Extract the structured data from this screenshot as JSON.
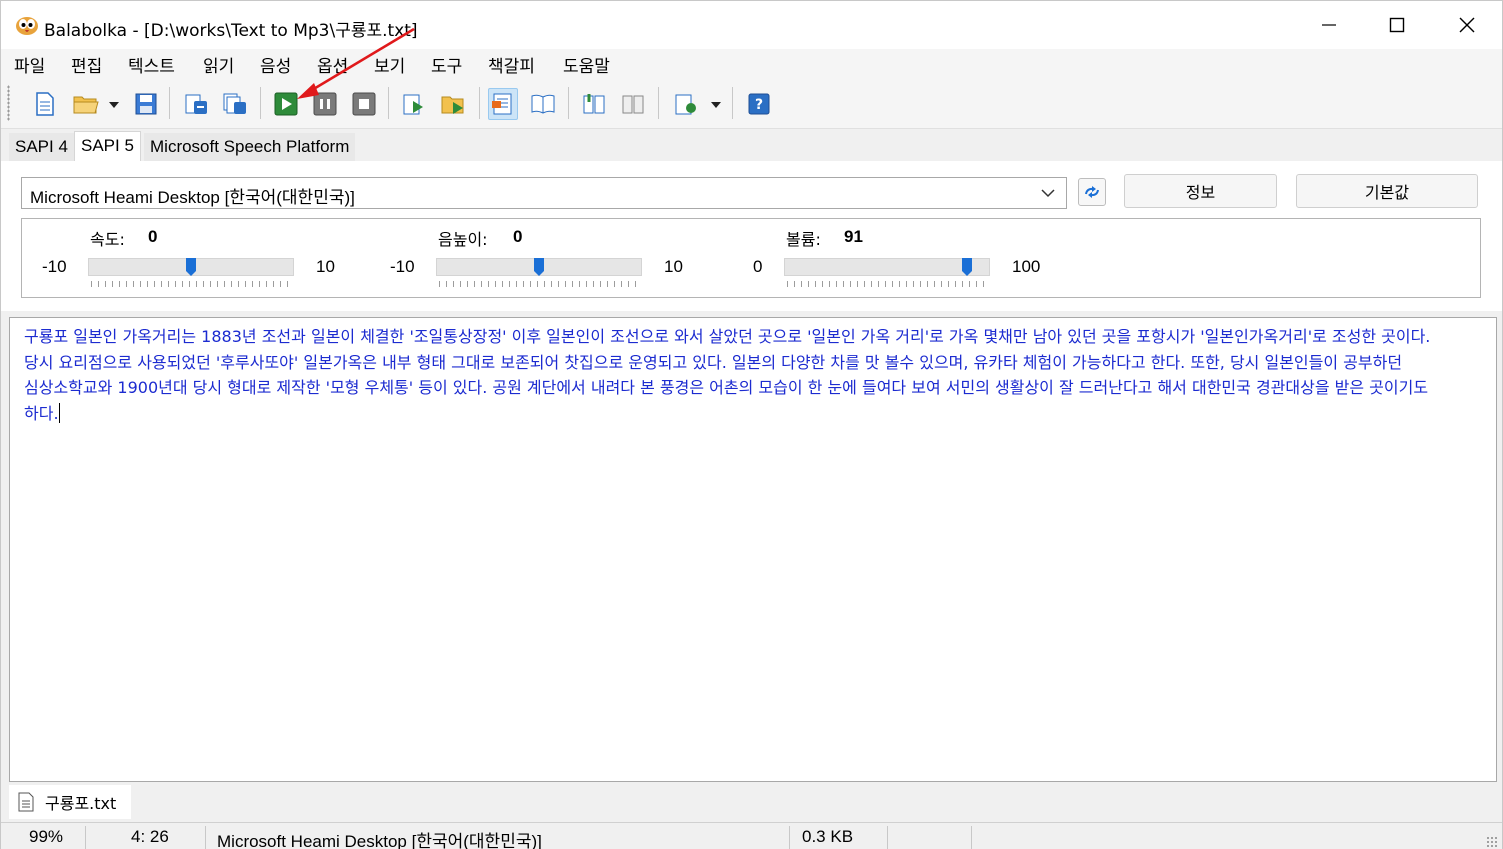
{
  "window": {
    "title": "Balabolka - [D:\\works\\Text to Mp3\\구룡포.txt]"
  },
  "menu": [
    "파일",
    "편집",
    "텍스트",
    "읽기",
    "음성",
    "옵션",
    "보기",
    "도구",
    "책갈피",
    "도움말"
  ],
  "toolbar": {
    "icons": [
      "new-file-icon",
      "open-folder-icon",
      "save-icon",
      "convert-icon",
      "batch-convert-icon",
      "play-icon",
      "pause-icon",
      "stop-icon",
      "read-clipboard-icon",
      "read-files-icon",
      "display-text-icon",
      "bookmark-icon",
      "split-icon",
      "join-icon",
      "audio-clips-icon",
      "help-icon"
    ]
  },
  "tabs": [
    "SAPI 4",
    "SAPI 5",
    "Microsoft Speech Platform"
  ],
  "voice": {
    "selected": "Microsoft Heami Desktop [한국어(대한민국)]",
    "info_button": "정보",
    "default_button": "기본값"
  },
  "sliders": {
    "rate": {
      "label": "속도:",
      "value": "0",
      "min": "-10",
      "max": "10",
      "level": 0.5
    },
    "pitch": {
      "label": "음높이:",
      "value": "0",
      "min": "-10",
      "max": "10",
      "level": 0.5
    },
    "volume": {
      "label": "볼륨:",
      "value": "91",
      "min": "0",
      "max": "100",
      "level": 0.91
    }
  },
  "editor": {
    "text": "구룡포 일본인 가옥거리는 1883년 조선과 일본이 체결한 '조일통상장정' 이후 일본인이 조선으로 와서 살았던 곳으로 '일본인 가옥 거리'로 가옥 몇채만 남아 있던 곳을 포항시가 '일본인가옥거리'로 조성한 곳이다. 당시 요리점으로 사용되었던 '후루사또야' 일본가옥은 내부 형태 그대로 보존되어 찻집으로 운영되고 있다. 일본의 다양한 차를 맛 볼수 있으며, 유카타 체험이 가능하다고 한다. 또한, 당시 일본인들이 공부하던 심상소학교와 1900년대 당시 형대로 제작한 '모형 우체통' 등이 있다. 공원 계단에서 내려다 본 풍경은 어촌의 모습이 한 눈에 들여다 보여 서민의 생활상이 잘 드러난다고 해서 대한민국 경관대상을 받은 곳이기도 하다."
  },
  "document_tab": "구룡포.txt",
  "status": {
    "zoom": "99%",
    "position": "4:  26",
    "voice": "Microsoft Heami Desktop [한국어(대한민국)]",
    "size": "0.3 KB"
  },
  "colors": {
    "editor_text": "#1c2bd0",
    "annotation_arrow": "#e0191b",
    "slider_thumb": "#1a6fd6"
  }
}
